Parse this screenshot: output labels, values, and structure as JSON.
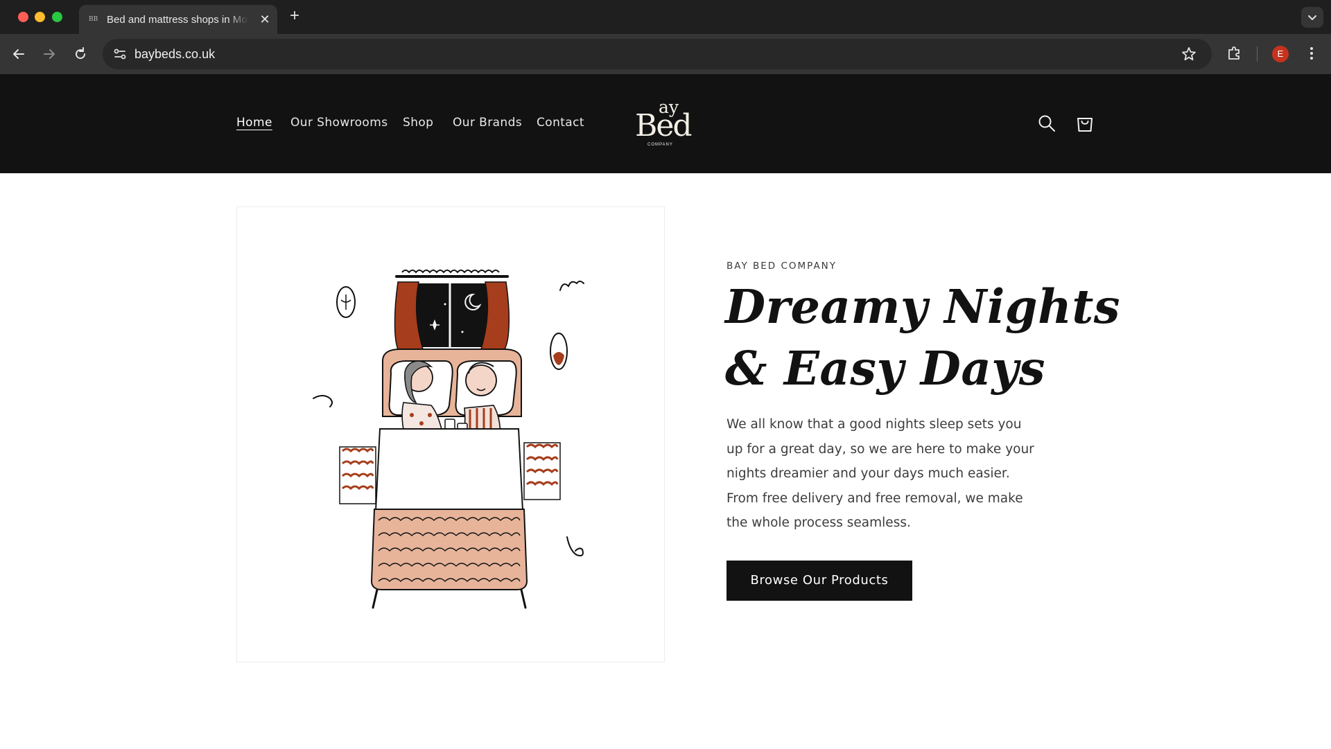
{
  "browser": {
    "tab_title": "Bed and mattress shops in Morecambe",
    "tab_favicon": "BB",
    "tab_close_glyph": "✕",
    "new_tab_glyph": "+",
    "url": "baybeds.co.uk",
    "profile_initial": "E"
  },
  "site": {
    "nav": [
      {
        "label": "Home",
        "active": true
      },
      {
        "label": "Our Showrooms"
      },
      {
        "label": "Shop"
      },
      {
        "label": "Our Brands"
      },
      {
        "label": "Contact"
      }
    ],
    "logo": {
      "top": "ay",
      "main": "Bed",
      "sub": "COMPANY"
    }
  },
  "hero": {
    "eyebrow": "BAY BED COMPANY",
    "headline_line1": "Dreamy Nights",
    "headline_line2": "& Easy Days",
    "body": "We all know that a good nights sleep sets you up for a great day, so we are here to make your nights dreamier and your days much easier. From free delivery and free removal, we make the whole process seamless.",
    "cta_label": "Browse Our Products",
    "illustration": "couple-in-bed-illustration"
  },
  "colors": {
    "header_bg": "#121212",
    "accent_rust": "#a63d1c",
    "bed_tan": "#e7b49a",
    "button_bg": "#121212"
  }
}
